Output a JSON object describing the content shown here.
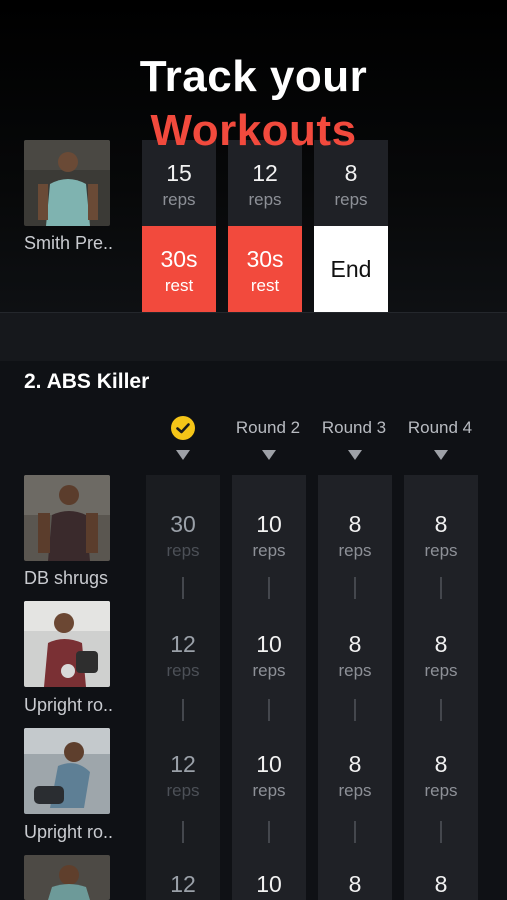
{
  "hero": {
    "line1": "Track your",
    "line2": "Workouts"
  },
  "top_exercise": {
    "name": "Smith Pre..",
    "photo_icon": "athlete-photo",
    "sets": [
      {
        "value": "15",
        "unit": "reps"
      },
      {
        "value": "12",
        "unit": "reps"
      },
      {
        "value": "8",
        "unit": "reps"
      }
    ],
    "actions": [
      {
        "value": "30s",
        "unit": "rest"
      },
      {
        "value": "30s",
        "unit": "rest"
      }
    ],
    "end_label": "End"
  },
  "workout": {
    "title": "2. ABS Killer",
    "completed_icon": "check-circle-icon",
    "rounds": [
      "Round 2",
      "Round 3",
      "Round 4"
    ],
    "exercises": [
      {
        "name": "DB shrugs",
        "values": [
          "30",
          "10",
          "8",
          "8"
        ]
      },
      {
        "name": "Upright ro..",
        "values": [
          "12",
          "10",
          "8",
          "8"
        ]
      },
      {
        "name": "Upright ro..",
        "values": [
          "12",
          "10",
          "8",
          "8"
        ]
      },
      {
        "name": "",
        "values": [
          "12",
          "10",
          "8",
          "8"
        ]
      }
    ],
    "unit": "reps"
  },
  "colors": {
    "accent": "#f24a3d",
    "check": "#f5c518",
    "background": "#0f1115"
  }
}
